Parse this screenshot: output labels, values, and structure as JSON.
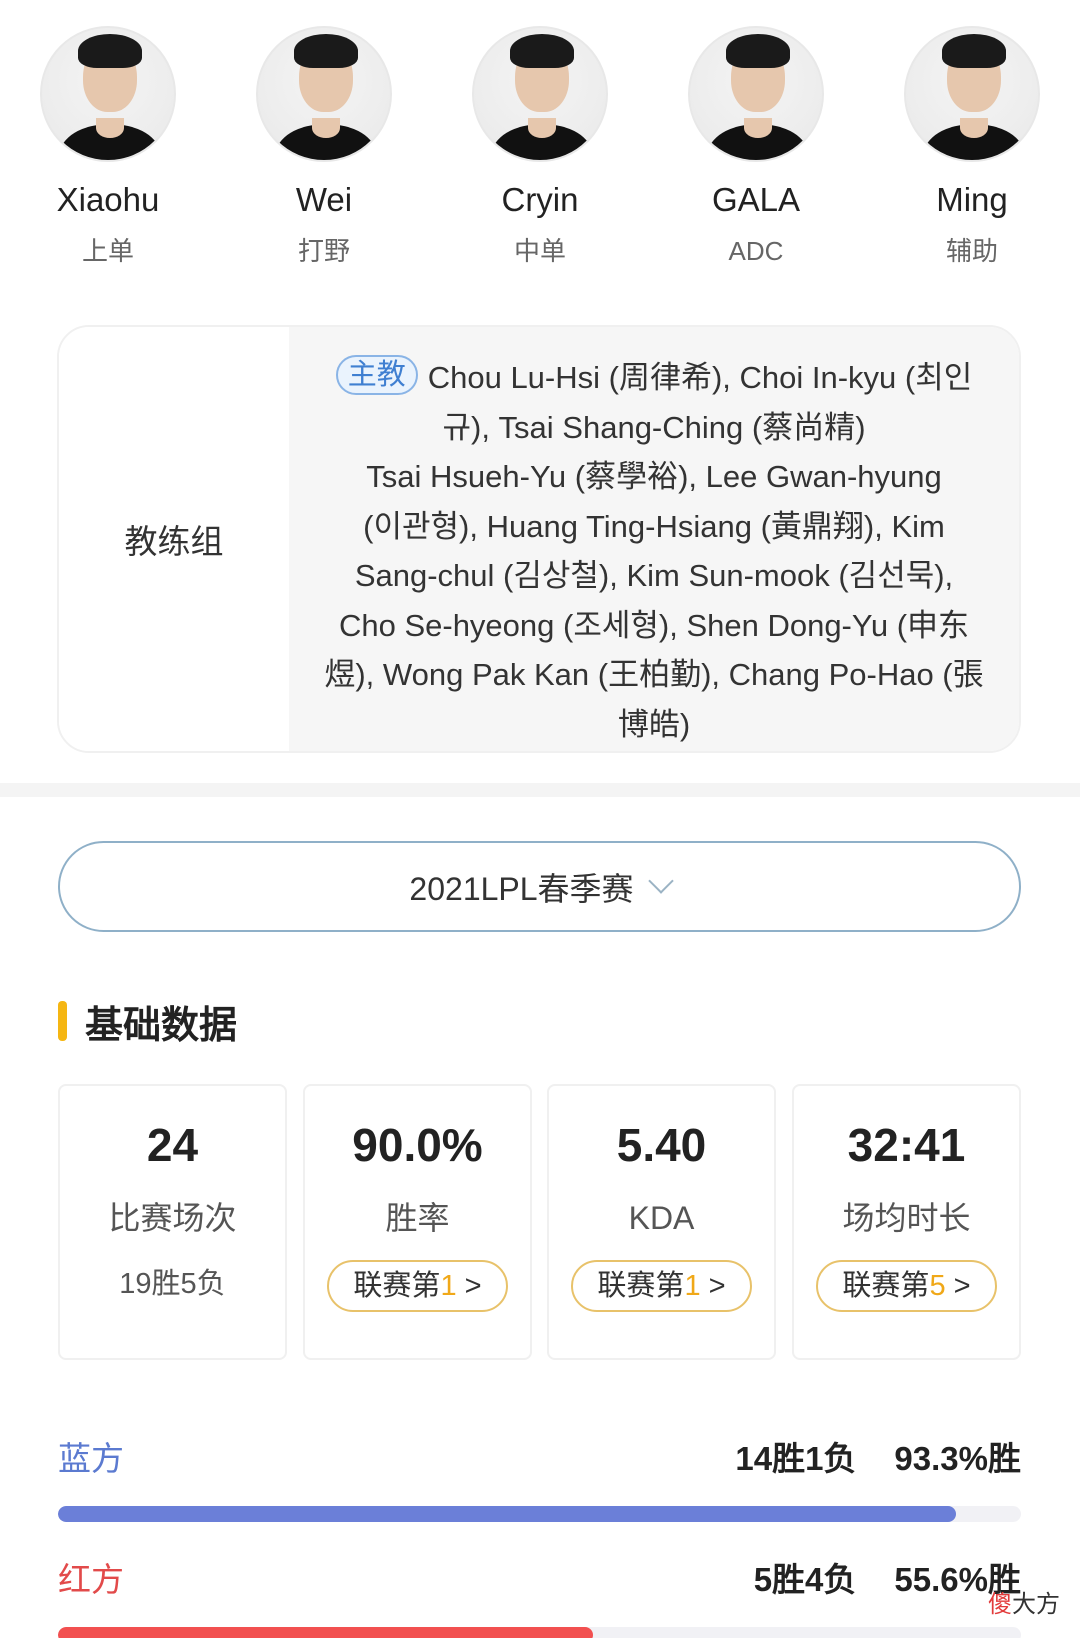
{
  "players": [
    {
      "name": "Xiaohu",
      "role": "上单"
    },
    {
      "name": "Wei",
      "role": "打野"
    },
    {
      "name": "Cryin",
      "role": "中单"
    },
    {
      "name": "GALA",
      "role": "ADC"
    },
    {
      "name": "Ming",
      "role": "辅助"
    }
  ],
  "coach": {
    "label": "教练组",
    "head_tag": "主教",
    "line1": "Chou Lu-Hsi (周律希), Choi In-kyu (최인",
    "line2": "규), Tsai Shang-Ching (蔡尚精)",
    "line3": "Tsai Hsueh-Yu (蔡學裕), Lee Gwan-hyung",
    "line4": "(이관형), Huang Ting-Hsiang (黃鼎翔), Kim",
    "line5": "Sang-chul (김상철), Kim Sun-mook (김선묵),",
    "line6": "Cho Se-hyeong (조세형), Shen Dong-Yu (申东",
    "line7": "煜), Wong Pak Kan (王柏勤), Chang Po-Hao (張",
    "line8": "博皓)"
  },
  "season": {
    "label": "2021LPL春季赛",
    "icon": "chevron-down-icon"
  },
  "section_title": "基础数据",
  "stats": [
    {
      "value": "24",
      "label": "比赛场次",
      "sub": "19胜5负"
    },
    {
      "value": "90.0%",
      "label": "胜率",
      "rank_prefix": "联赛第",
      "rank": "1",
      "rank_suffix": ">"
    },
    {
      "value": "5.40",
      "label": "KDA",
      "rank_prefix": "联赛第",
      "rank": "1",
      "rank_suffix": ">"
    },
    {
      "value": "32:41",
      "label": "场均时长",
      "rank_prefix": "联赛第",
      "rank": "5",
      "rank_suffix": ">"
    }
  ],
  "sides": [
    {
      "name": "蓝方",
      "record": "14胜1负",
      "rate_text": "93.3%胜",
      "rate": 93.3,
      "color": "#6b7fd8",
      "name_color": "#5b7ad0"
    },
    {
      "name": "红方",
      "record": "5胜4负",
      "rate_text": "55.6%胜",
      "rate": 55.6,
      "color": "#f25050",
      "name_color": "#e24a4a"
    }
  ],
  "watermark": {
    "first": "傻",
    "rest": "大方"
  }
}
